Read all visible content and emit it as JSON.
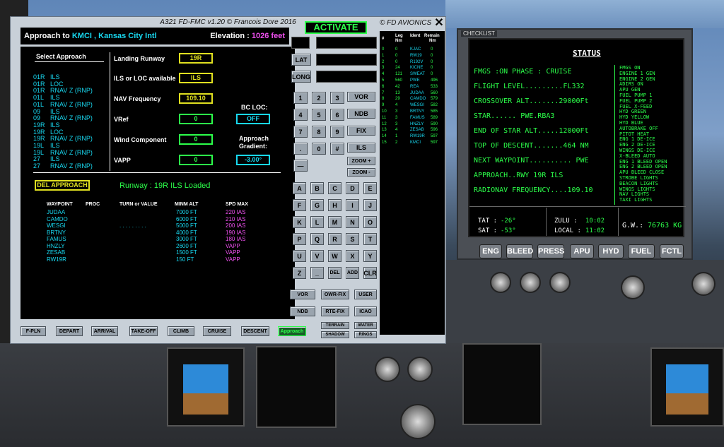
{
  "fmc": {
    "window_title": "A321 FD-FMC v1.20  © Francois Dore 2016",
    "brand": "© FD AVIONICS",
    "activate_label": "ACTIVATE",
    "approach_prefix": "Approach to",
    "approach_airport": "KMCI , Kansas City Intl",
    "elevation_label": "Elevation :",
    "elevation_value": "1026 feet",
    "select_approach_label": "Select Approach",
    "approaches": [
      {
        "rwy": "01R",
        "type": "ILS"
      },
      {
        "rwy": "01R",
        "type": "LOC"
      },
      {
        "rwy": "01R",
        "type": "RNAV Z (RNP)"
      },
      {
        "rwy": "01L",
        "type": "ILS"
      },
      {
        "rwy": "01L",
        "type": "RNAV Z (RNP)"
      },
      {
        "rwy": "09",
        "type": "ILS"
      },
      {
        "rwy": "09",
        "type": "RNAV Z (RNP)"
      },
      {
        "rwy": "19R",
        "type": "ILS"
      },
      {
        "rwy": "19R",
        "type": "LOC"
      },
      {
        "rwy": "19R",
        "type": "RNAV Z (RNP)"
      },
      {
        "rwy": "19L",
        "type": "ILS"
      },
      {
        "rwy": "19L",
        "type": "RNAV Z (RNP)"
      },
      {
        "rwy": "27",
        "type": "ILS"
      },
      {
        "rwy": "27",
        "type": "RNAV Z (RNP)"
      }
    ],
    "landing_runway_label": "Landing Runway",
    "landing_runway_value": "19R",
    "ils_loc_label": "ILS or LOC available",
    "ils_loc_value": "ILS",
    "nav_freq_label": "NAV Frequency",
    "nav_freq_value": "109.10",
    "vref_label": "VRef",
    "vref_value": "0",
    "wind_label": "Wind Component",
    "wind_value": "0",
    "vapp_label": "VAPP",
    "vapp_value": "0",
    "bc_loc_label": "BC LOC:",
    "bc_loc_value": "OFF",
    "gradient_label_1": "Approach",
    "gradient_label_2": "Gradient:",
    "gradient_value": "-3.00°",
    "del_approach_label": "DEL APPROACH",
    "status_loaded": "Runway : 19R  ILS  Loaded",
    "table_headers": {
      "waypoint": "WAYPOINT",
      "proc": "PROC",
      "turn": "TURN or VALUE",
      "alt": "MINM ALT",
      "spd": "SPD MAX"
    },
    "waypoints": [
      {
        "name": "JUDAA",
        "proc": "",
        "turn": "",
        "alt": "7000 FT",
        "spd": "220 IAS"
      },
      {
        "name": "CAMDO",
        "proc": "",
        "turn": "",
        "alt": "6000 FT",
        "spd": "210 IAS"
      },
      {
        "name": "WESGI",
        "proc": "",
        "turn": ". . . . . . . . .",
        "alt": "5000 FT",
        "spd": "200 IAS"
      },
      {
        "name": "BRTNY",
        "proc": "",
        "turn": "",
        "alt": "4000 FT",
        "spd": "190 IAS"
      },
      {
        "name": "FAMUS",
        "proc": "",
        "turn": "",
        "alt": "3000 FT",
        "spd": "180 IAS"
      },
      {
        "name": "HNZLY",
        "proc": "",
        "turn": "",
        "alt": "2600 FT",
        "spd": "VAPP"
      },
      {
        "name": "ZESAB",
        "proc": "",
        "turn": "",
        "alt": "1500 FT",
        "spd": "VAPP"
      },
      {
        "name": "RW19R",
        "proc": "",
        "turn": "",
        "alt": "150 FT",
        "spd": "VAPP"
      }
    ],
    "lat_label": "LAT",
    "long_label": "LONG",
    "numpad": [
      "1",
      "2",
      "3",
      "4",
      "5",
      "6",
      "7",
      "8",
      "9",
      ".",
      "0",
      "#"
    ],
    "minus_key": "—",
    "nav_keys": [
      "VOR",
      "NDB",
      "FIX",
      "ILS"
    ],
    "zoom_in": "ZOOM +",
    "zoom_out": "ZOOM -",
    "letters": [
      "A",
      "B",
      "C",
      "D",
      "E",
      "F",
      "G",
      "H",
      "I",
      "J",
      "K",
      "L",
      "M",
      "N",
      "O",
      "P",
      "Q",
      "R",
      "S",
      "T",
      "U",
      "V",
      "W",
      "X",
      "Y",
      "Z"
    ],
    "blank_key": "_",
    "del_key": "DEL",
    "add_key": "ADD",
    "clr_key": "CLR",
    "bottom_keys_r1": [
      "VOR",
      "OWR-FIX",
      "USER"
    ],
    "bottom_keys_r2": [
      "NDB",
      "RTE-FIX",
      "ICAO"
    ],
    "terrain": "TERRAIN",
    "shadow": "SHADOW",
    "water": "WATER",
    "rings": "RINGS",
    "phase_tabs": [
      "F-PLN",
      "DEPART",
      "ARRIVAL",
      "TAKE-OFF",
      "CLIMB",
      "CRUISE",
      "DESCENT",
      "Approach"
    ],
    "list_headers": {
      "num": "#",
      "leg": "Leg",
      "leg2": "Nm",
      "ident": "Ident",
      "remain": "Remain",
      "remain2": "Nm"
    },
    "legs": [
      {
        "n": "0",
        "leg": "0",
        "ident": "KJAC",
        "remain": "0"
      },
      {
        "n": "1",
        "leg": "0",
        "ident": "RW19",
        "remain": "0"
      },
      {
        "n": "2",
        "leg": "0",
        "ident": "R192V",
        "remain": "0"
      },
      {
        "n": "3",
        "leg": "24",
        "ident": "KICNE",
        "remain": "0"
      },
      {
        "n": "4",
        "leg": "121",
        "ident": "SWEAT",
        "remain": "0"
      },
      {
        "n": "5",
        "leg": "560",
        "ident": "PWE",
        "remain": "496"
      },
      {
        "n": "6",
        "leg": "42",
        "ident": "REA",
        "remain": "533"
      },
      {
        "n": "7",
        "leg": "13",
        "ident": "JUDAA",
        "remain": "560"
      },
      {
        "n": "8",
        "leg": "29",
        "ident": "CAMDO",
        "remain": "579"
      },
      {
        "n": "9",
        "leg": "4",
        "ident": "WESGI",
        "remain": "582"
      },
      {
        "n": "10",
        "leg": "3",
        "ident": "BRTNY",
        "remain": "585"
      },
      {
        "n": "11",
        "leg": "3",
        "ident": "FAMUS",
        "remain": "589"
      },
      {
        "n": "12",
        "leg": "3",
        "ident": "HNZLY",
        "remain": "590"
      },
      {
        "n": "13",
        "leg": "4",
        "ident": "ZESAB",
        "remain": "596"
      },
      {
        "n": "14",
        "leg": "1",
        "ident": "RW19R",
        "remain": "597"
      },
      {
        "n": "15",
        "leg": "2",
        "ident": "KMCI",
        "remain": "597"
      }
    ]
  },
  "checklist": {
    "label": "CHECKLIST",
    "title": "STATUS",
    "lines": [
      "FMGS :ON  PHASE :  CRUISE",
      "FLIGHT LEVEL.........FL332",
      "CROSSOVER ALT.......29000Ft",
      "STAR......        PWE.RBA3",
      "END OF STAR ALT.....12000Ft",
      "TOP OF DESCENT.......464 NM",
      "NEXT WAYPOINT..........  PWE",
      "APPROACH..RWY 19R       ILS",
      "RADIONAV FREQUENCY....109.10"
    ],
    "items": [
      "FMGS ON",
      "ENGINE 1 GEN",
      "ENGINE 2 GEN",
      "ADIRS ON",
      "APU GEN",
      "FUEL PUMP 1",
      "FUEL PUMP 2",
      "FUEL X-FEED",
      "HYD GREEN",
      "HYD YELLOW",
      "HYD BLUE",
      "AUTOBRAKE OFF",
      "PITOT HEAT",
      "ENG 1 DE-ICE",
      "ENG 2 DE-ICE",
      "WINGS DE-ICE",
      "X-BLEED AUTO",
      "ENG 1 BLEED OPEN",
      "ENG 2 BLEED OPEN",
      "APU BLEED CLOSE",
      "STROBE LIGHTS",
      "BEACON LIGHTS",
      "WINGS LIGHTS",
      "NAV LIGHTS",
      "TAXI LIGHTS"
    ],
    "tat_label": "TAT :",
    "tat_value": "-26°",
    "sat_label": "SAT :",
    "sat_value": "-53°",
    "zulu_label": "ZULU :",
    "zulu_value": "10:02",
    "local_label": "LOCAL :",
    "local_value": "11:02",
    "gw_label": "G.W.:",
    "gw_value": "76763 KG",
    "buttons": [
      "ENG",
      "BLEED",
      "PRESS",
      "APU",
      "HYD",
      "FUEL",
      "FCTL"
    ]
  },
  "colors": {
    "green": "#2cff4a",
    "cyan": "#18d8f0",
    "magenta": "#f050f0",
    "yellow": "#e0e020"
  }
}
